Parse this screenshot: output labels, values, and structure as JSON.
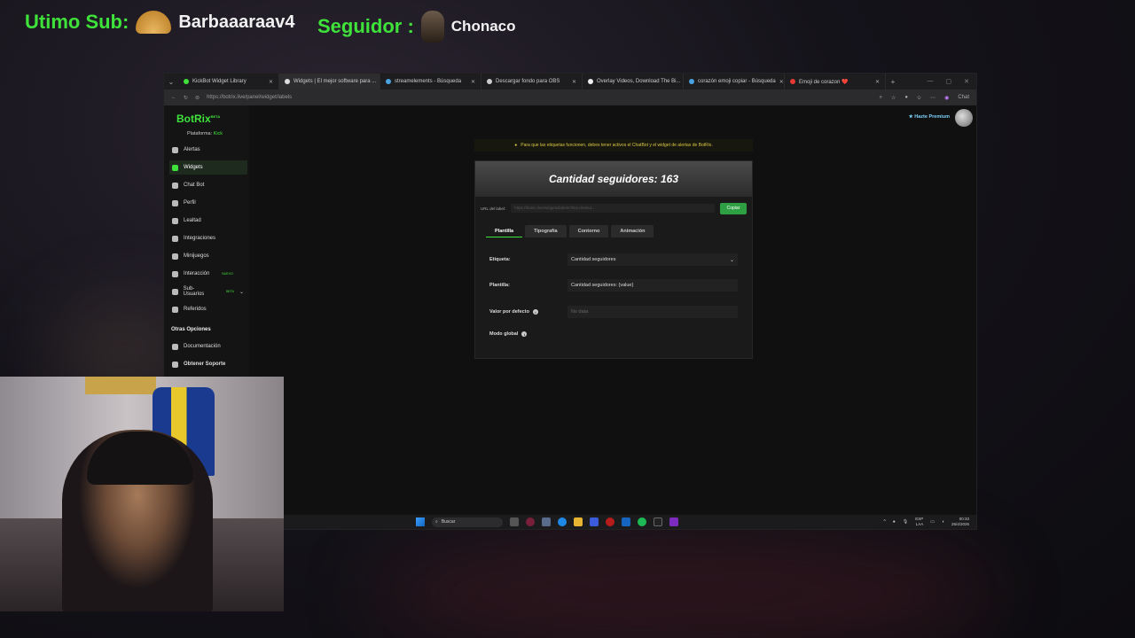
{
  "overlay": {
    "sub_label": "Utimo Sub:",
    "sub_name": "Barbaaaraav4",
    "follower_label": "Seguidor :",
    "follower_name": "Chonaco"
  },
  "browser": {
    "tabs": [
      {
        "label": "KickBot Widget Library",
        "active": false
      },
      {
        "label": "Widgets | El mejor software para ...",
        "active": true
      },
      {
        "label": "streamelements - Búsqueda",
        "active": false
      },
      {
        "label": "Descargar fondo para OBS",
        "active": false
      },
      {
        "label": "Overlay Videos, Download The Bi...",
        "active": false
      },
      {
        "label": "corazón emoji copiar - Búsqueda",
        "active": false
      },
      {
        "label": "Emoji de corazon ❤️",
        "active": false
      }
    ],
    "url": "https://botrix.live/panel/widget/labels",
    "chat_label": "Chat"
  },
  "app": {
    "brand": "BotRix",
    "brand_badge": "BETA",
    "platform_label": "Plataforma:",
    "platform_value": "Kick",
    "premium_label": "Hazte Premium",
    "nav": [
      {
        "label": "Alertas",
        "icon": "alert-icon",
        "active": false,
        "badge": ""
      },
      {
        "label": "Widgets",
        "icon": "widgets-icon",
        "active": true,
        "badge": ""
      },
      {
        "label": "Chat Bot",
        "icon": "chatbot-icon",
        "active": false,
        "badge": ""
      },
      {
        "label": "Perfil",
        "icon": "profile-icon",
        "active": false,
        "badge": ""
      },
      {
        "label": "Lealtad",
        "icon": "loyalty-icon",
        "active": false,
        "badge": ""
      },
      {
        "label": "Integraciones",
        "icon": "integrations-icon",
        "active": false,
        "badge": ""
      },
      {
        "label": "Minijuegos",
        "icon": "gamepad-icon",
        "active": false,
        "badge": ""
      },
      {
        "label": "Interacción",
        "icon": "music-icon",
        "active": false,
        "badge": "NUEVO"
      },
      {
        "label": "Sub-Usuarios",
        "icon": "sub-users-icon",
        "active": false,
        "badge": "BETA"
      },
      {
        "label": "Referidos",
        "icon": "referrals-icon",
        "active": false,
        "badge": ""
      }
    ],
    "other_section_title": "Otras Opciones",
    "other_nav": [
      {
        "label": "Documentación",
        "icon": "docs-icon"
      },
      {
        "label": "Obtener Soporte",
        "icon": "support-icon"
      }
    ],
    "notice": "Para que las etiquetas funcionen, debes tener activos el ChatBot y el widget de alertas de BotRix.",
    "card_title": "Cantidad seguidores: 163",
    "url_label": "URL del label:",
    "url_value": "https://botrix.live/widgets/labels?bid=r0x8w1...",
    "copy_label": "Copiar",
    "panel_tabs": [
      {
        "label": "Plantilla",
        "active": true
      },
      {
        "label": "Tipografía",
        "active": false
      },
      {
        "label": "Contorno",
        "active": false
      },
      {
        "label": "Animación",
        "active": false
      }
    ],
    "form": {
      "etiqueta_label": "Etiqueta:",
      "etiqueta_value": "Cantidad seguidores",
      "plantilla_label": "Plantilla:",
      "plantilla_value": "Cantidad seguidores: {value}",
      "default_label": "Valor por defecto",
      "default_placeholder": "No data",
      "global_label": "Modo global"
    }
  },
  "taskbar": {
    "search_label": "Buscar",
    "lang_top": "ESP",
    "lang_bottom": "LAA",
    "time": "00:33",
    "date": "26/4/2026"
  }
}
